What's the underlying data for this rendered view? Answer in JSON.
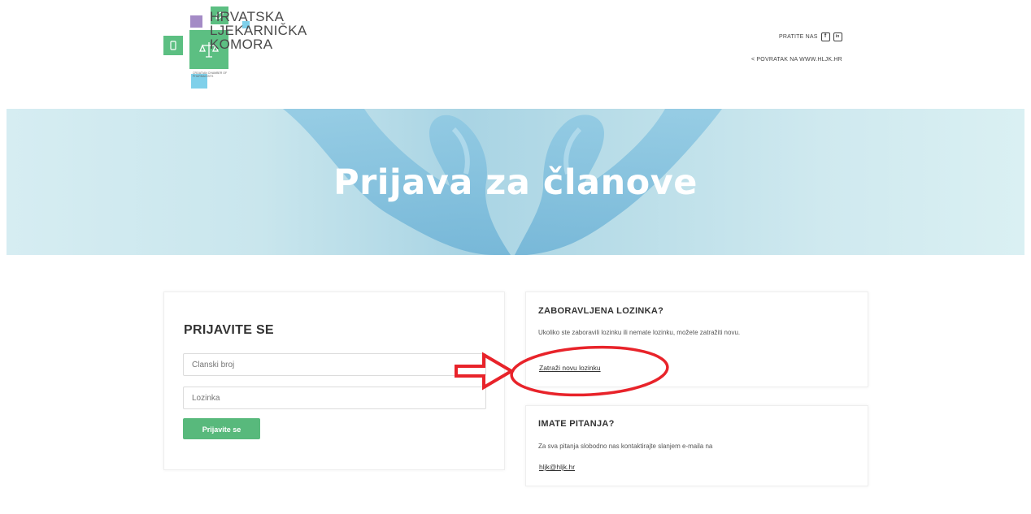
{
  "header": {
    "logo": {
      "line1": "HRVATSKA",
      "line2": "LJEKARNIČKA",
      "line3": "KOMORA",
      "small_text": "CROATIAN CHAMBER OF PHARMACISTS"
    },
    "follow_label": "PRATITE NAS",
    "social": [
      {
        "icon": "facebook-icon",
        "glyph": "f"
      },
      {
        "icon": "linkedin-icon",
        "glyph": "in"
      }
    ],
    "back_link": "< POVRATAK NA WWW.HLJK.HR"
  },
  "banner": {
    "title": "Prijava za članove"
  },
  "login": {
    "title": "PRIJAVITE SE",
    "member_number_placeholder": "Članski broj",
    "password_placeholder": "Lozinka",
    "submit_label": "Prijavite se"
  },
  "forgot": {
    "title": "ZABORAVLJENA LOZINKA?",
    "text": "Ukoliko ste zaboravili lozinku ili nemate lozinku, možete zatražiti novu.",
    "link": "Zatraži novu lozinku"
  },
  "questions": {
    "title": "IMATE PITANJA?",
    "text": "Za sva pitanja slobodno nas kontaktirajte slanjem e-maila na",
    "email": "hljk@hljk.hr"
  },
  "colors": {
    "accent": "#58b97c",
    "annotation": "#e8232a",
    "logo_green": "#5cbf82",
    "logo_purple": "#a48bc6",
    "logo_blue": "#7fd0ea"
  }
}
